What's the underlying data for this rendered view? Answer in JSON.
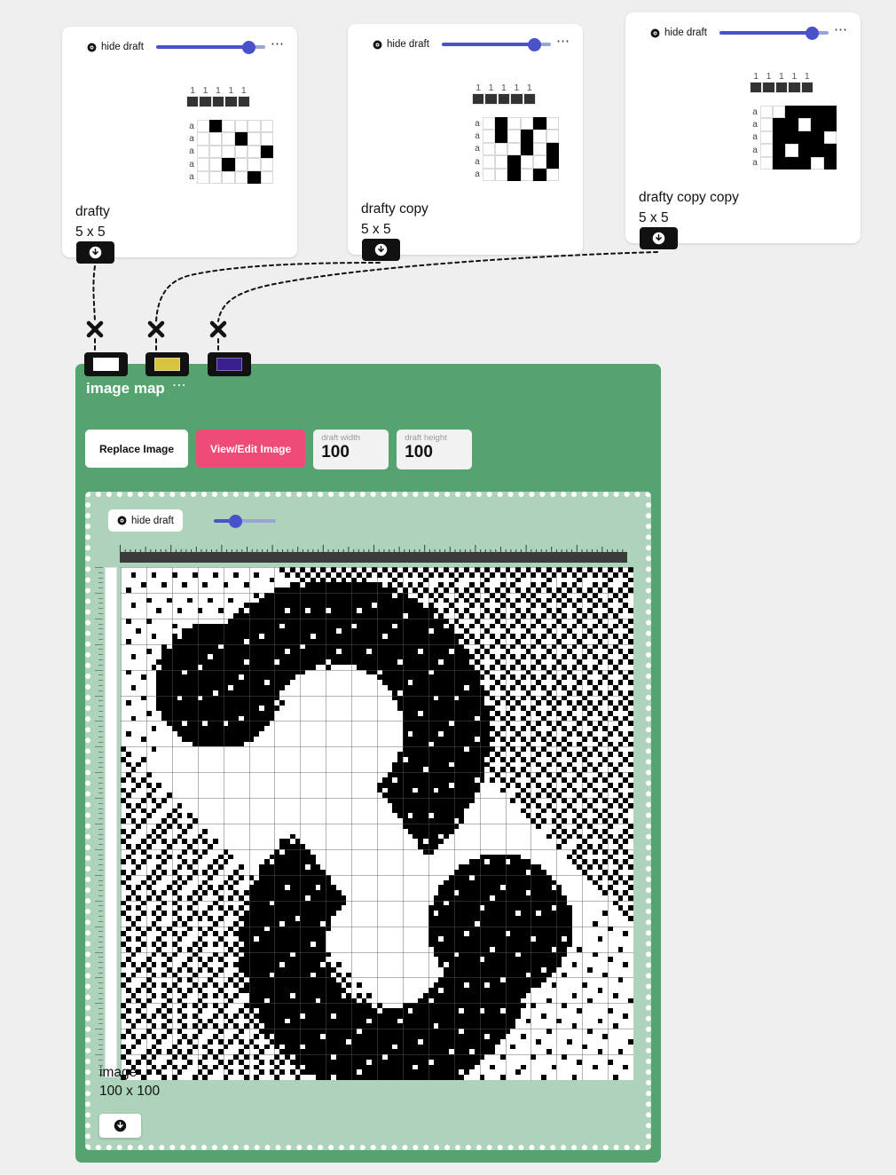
{
  "cards": [
    {
      "hide_draft_label": "hide draft",
      "eye_icon": "eye-icon",
      "menu_icon": "dots-menu-icon",
      "slider_value": 85,
      "tieup_numbers": [
        "1",
        "1",
        "1",
        "1",
        "1"
      ],
      "shaft_labels": [
        "a",
        "a",
        "a",
        "a",
        "a"
      ],
      "grid": [
        [
          1,
          0,
          0,
          0,
          0
        ],
        [
          0,
          0,
          1,
          0,
          0
        ],
        [
          0,
          0,
          0,
          0,
          1
        ],
        [
          0,
          1,
          0,
          0,
          0
        ],
        [
          0,
          0,
          0,
          1,
          0
        ]
      ],
      "name": "drafty",
      "size": "5 x 5",
      "download_icon": "download-icon"
    },
    {
      "hide_draft_label": "hide draft",
      "eye_icon": "eye-icon",
      "menu_icon": "dots-menu-icon",
      "slider_value": 85,
      "tieup_numbers": [
        "1",
        "1",
        "1",
        "1",
        "1"
      ],
      "shaft_labels": [
        "a",
        "a",
        "a",
        "a",
        "a"
      ],
      "grid": [
        [
          1,
          0,
          0,
          1,
          0
        ],
        [
          1,
          0,
          1,
          0,
          0
        ],
        [
          0,
          0,
          1,
          0,
          1
        ],
        [
          0,
          1,
          0,
          0,
          1
        ],
        [
          0,
          1,
          0,
          1,
          0
        ]
      ],
      "name": "drafty copy",
      "size": "5 x 5",
      "download_icon": "download-icon"
    },
    {
      "hide_draft_label": "hide draft",
      "eye_icon": "eye-icon",
      "menu_icon": "dots-menu-icon",
      "slider_value": 85,
      "tieup_numbers": [
        "1",
        "1",
        "1",
        "1",
        "1"
      ],
      "shaft_labels": [
        "a",
        "a",
        "a",
        "a",
        "a"
      ],
      "grid": [
        [
          0,
          1,
          1,
          1,
          1
        ],
        [
          1,
          1,
          0,
          1,
          1
        ],
        [
          1,
          1,
          1,
          1,
          0
        ],
        [
          1,
          0,
          1,
          1,
          1
        ],
        [
          1,
          1,
          1,
          0,
          1
        ]
      ],
      "name": "drafty copy copy",
      "size": "5 x 5",
      "download_icon": "download-icon"
    }
  ],
  "chips": [
    {
      "name": "chip-white",
      "color": "#ffffff"
    },
    {
      "name": "chip-yellow",
      "color": "#d9c440"
    },
    {
      "name": "chip-purple",
      "color": "#3a1f8f"
    }
  ],
  "connectors": [
    {
      "marker": "x-marker"
    },
    {
      "marker": "x-marker"
    },
    {
      "marker": "x-marker"
    }
  ],
  "panel": {
    "title": "image map",
    "menu_icon": "dots-menu-icon",
    "bg_color": "#55a46f",
    "inner_bg_color": "#aed3bb",
    "buttons": {
      "replace_image": "Replace Image",
      "view_edit_image": "View/Edit Image",
      "accent_color": "#ee4b77"
    },
    "fields": [
      {
        "label": "draft width",
        "value": "100"
      },
      {
        "label": "draft height",
        "value": "100"
      }
    ],
    "inner": {
      "hide_draft_label": "hide draft",
      "eye_icon": "eye-icon",
      "slider_value": 35,
      "image_name": "image",
      "image_size": "100 x 100",
      "download_icon": "download-icon"
    }
  }
}
